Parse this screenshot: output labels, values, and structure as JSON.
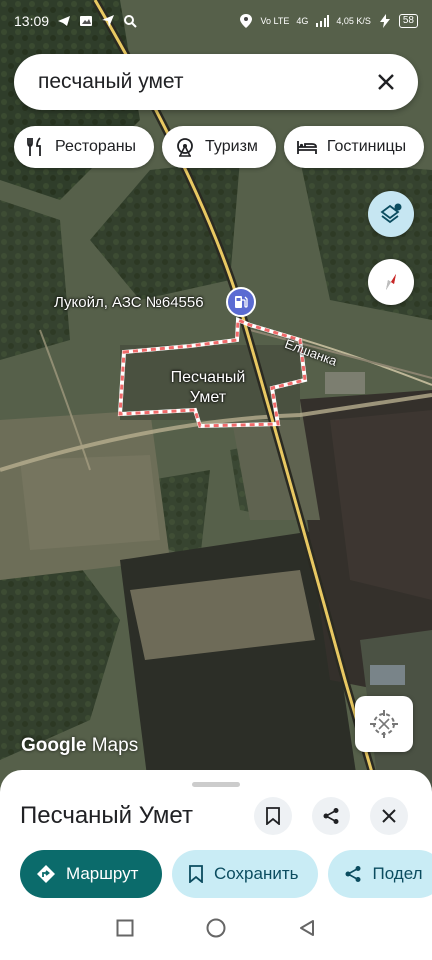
{
  "status_bar": {
    "time": "13:09",
    "net_label": "Vo LTE",
    "signal_label": "4G",
    "speed": "4,05 K/S",
    "battery": "58"
  },
  "search": {
    "query": "песчаный умет"
  },
  "chips": [
    {
      "label": "Рестораны",
      "icon": "fork-knife-icon"
    },
    {
      "label": "Туризм",
      "icon": "ferris-wheel-icon"
    },
    {
      "label": "Гостиницы",
      "icon": "bed-icon"
    }
  ],
  "map": {
    "poi_label": "Лукойл, АЗС №64556",
    "place_label_line1": "Песчаный",
    "place_label_line2": "Умет",
    "road_label": "Елшанка",
    "wordmark_google": "Google",
    "wordmark_maps": "Maps"
  },
  "sheet": {
    "title": "Песчаный Умет",
    "actions": [
      {
        "label": "Маршрут",
        "icon": "directions-icon"
      },
      {
        "label": "Сохранить",
        "icon": "bookmark-icon"
      },
      {
        "label": "Подел",
        "icon": "share-icon"
      }
    ]
  },
  "colors": {
    "primary": "#0b6b6b",
    "secondary": "#c9ecf5",
    "boundary": "#f06a6a",
    "road": "#e8c862"
  }
}
